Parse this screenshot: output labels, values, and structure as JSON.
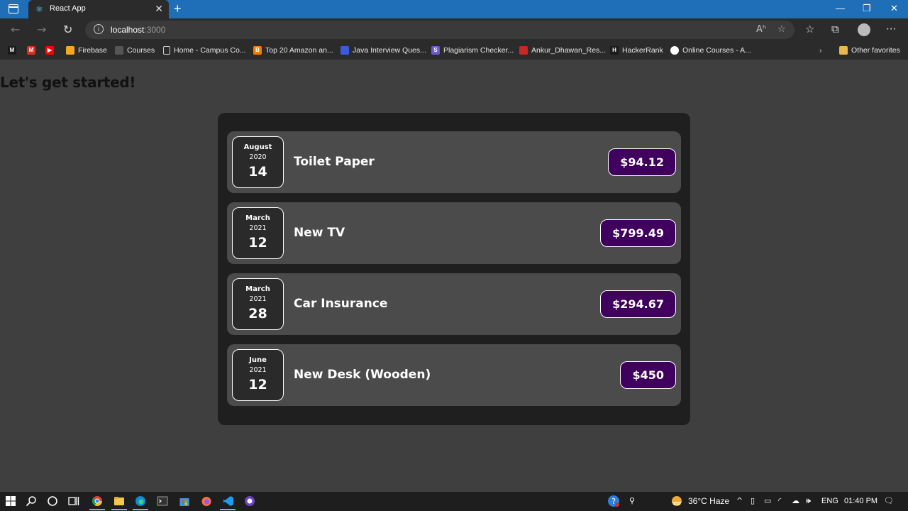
{
  "browser": {
    "tab_title": "React App",
    "tab_close": "✕",
    "new_tab": "+",
    "url_host": "localhost",
    "url_port": ":3000",
    "window_controls": {
      "minimize": "—",
      "restore": "❐",
      "close": "✕"
    },
    "reader_label": "Aʰ",
    "more_label": "···"
  },
  "bookmarks": {
    "items": [
      {
        "label": "",
        "icon": "medium-icon",
        "color": "#1a1a1a",
        "glyph": "M"
      },
      {
        "label": "",
        "icon": "gmail-icon",
        "color": "#d93025",
        "glyph": "M"
      },
      {
        "label": "",
        "icon": "youtube-icon",
        "color": "#ff0000",
        "glyph": "▶"
      },
      {
        "label": "Firebase",
        "icon": "firebase-icon",
        "color": "#f5a623",
        "glyph": ""
      },
      {
        "label": "Courses",
        "icon": "courses-icon",
        "color": "#555555",
        "glyph": ""
      },
      {
        "label": "Home - Campus Co...",
        "icon": "page-icon",
        "color": "transparent",
        "glyph": ""
      },
      {
        "label": "Top 20 Amazon an...",
        "icon": "blogger-icon",
        "color": "#f57c00",
        "glyph": "B"
      },
      {
        "label": "Java Interview Ques...",
        "icon": "site-icon",
        "color": "#3b5bdb",
        "glyph": ""
      },
      {
        "label": "Plagiarism Checker...",
        "icon": "sst-icon",
        "color": "#6a5acd",
        "glyph": "S"
      },
      {
        "label": "Ankur_Dhawan_Res...",
        "icon": "pdf-icon",
        "color": "#c62828",
        "glyph": ""
      },
      {
        "label": "HackerRank",
        "icon": "hackerrank-icon",
        "color": "#1a1a1a",
        "glyph": "H"
      },
      {
        "label": "Online Courses - A...",
        "icon": "online-courses-icon",
        "color": "#ffffff",
        "glyph": ""
      }
    ],
    "other_favorites": "Other favorites"
  },
  "page": {
    "heading": "Let's get started!"
  },
  "expenses": [
    {
      "month": "August",
      "year": "2020",
      "day": "14",
      "title": "Toilet Paper",
      "amount": "$94.12"
    },
    {
      "month": "March",
      "year": "2021",
      "day": "12",
      "title": "New TV",
      "amount": "$799.49"
    },
    {
      "month": "March",
      "year": "2021",
      "day": "28",
      "title": "Car Insurance",
      "amount": "$294.67"
    },
    {
      "month": "June",
      "year": "2021",
      "day": "12",
      "title": "New Desk (Wooden)",
      "amount": "$450"
    }
  ],
  "taskbar": {
    "weather": "36°C  Haze",
    "language": "ENG",
    "time": "01:40 PM"
  },
  "colors": {
    "accent_titlebar": "#1f6fb8",
    "price_bg": "#40005d",
    "page_bg": "#3f3f3f",
    "card_bg": "#1f1f1f",
    "item_bg": "#4b4b4b"
  }
}
